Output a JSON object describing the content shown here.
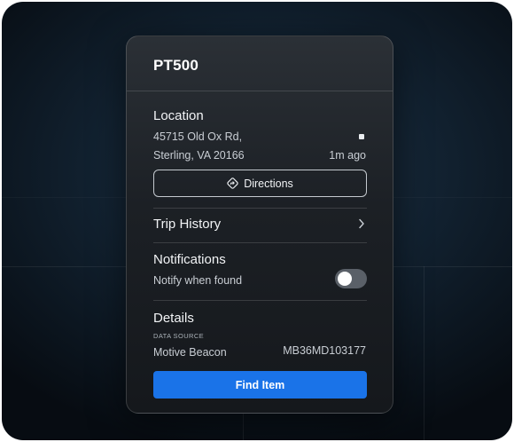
{
  "colors": {
    "accent": "#1a73e8",
    "toggle_off": "#5a6068"
  },
  "card": {
    "title": "PT500",
    "location": {
      "title": "Location",
      "address_line1": "45715 Old Ox Rd,",
      "address_line2": "Sterling, VA 20166",
      "timestamp": "1m ago",
      "directions_label": "Directions",
      "directions_icon": "directions-diamond-icon"
    },
    "trip_history": {
      "label": "Trip History",
      "icon": "chevron-right-icon"
    },
    "notifications": {
      "title": "Notifications",
      "toggle_label": "Notify when found",
      "toggle_on": false
    },
    "details": {
      "title": "Details",
      "data_source_label": "DATA SOURCE",
      "data_source_value": "Motive Beacon",
      "device_id": "MB36MD103177"
    },
    "find_button_label": "Find Item"
  }
}
